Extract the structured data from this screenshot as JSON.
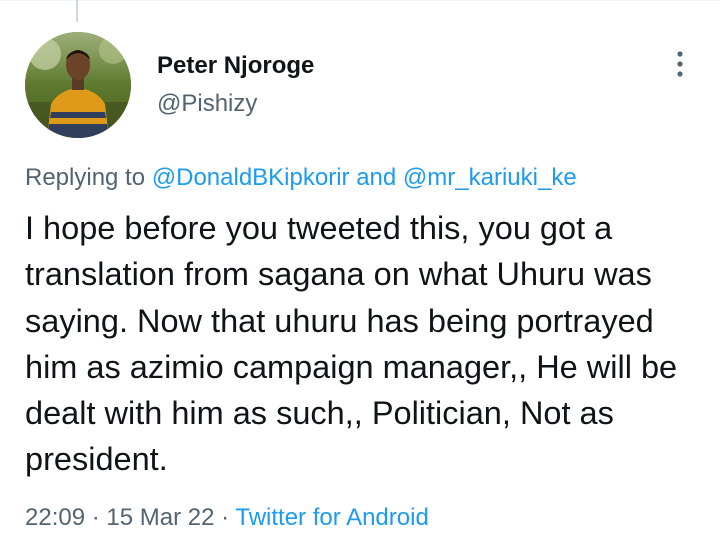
{
  "author": {
    "display_name": "Peter Njoroge",
    "handle": "@Pishizy"
  },
  "reply_context": {
    "prefix": "Replying to",
    "mention_1": "@DonaldBKipkorir",
    "conjunction": "and",
    "mention_2": "@mr_kariuki_ke"
  },
  "tweet": {
    "text": "I hope before you tweeted this, you got a translation from sagana on what Uhuru was saying. Now that uhuru has being portrayed him as azimio campaign manager,, He will be dealt with him as such,, Politician, Not as president."
  },
  "meta": {
    "time": "22:09",
    "separator_1": "·",
    "date": "15 Mar 22",
    "separator_2": "·",
    "source": "Twitter for Android"
  },
  "icons": {
    "more": "more-vertical-icon",
    "avatar": "avatar-image"
  },
  "colors": {
    "link": "#1d9bf0",
    "secondary_text": "#536471",
    "primary_text": "#0f1419"
  }
}
